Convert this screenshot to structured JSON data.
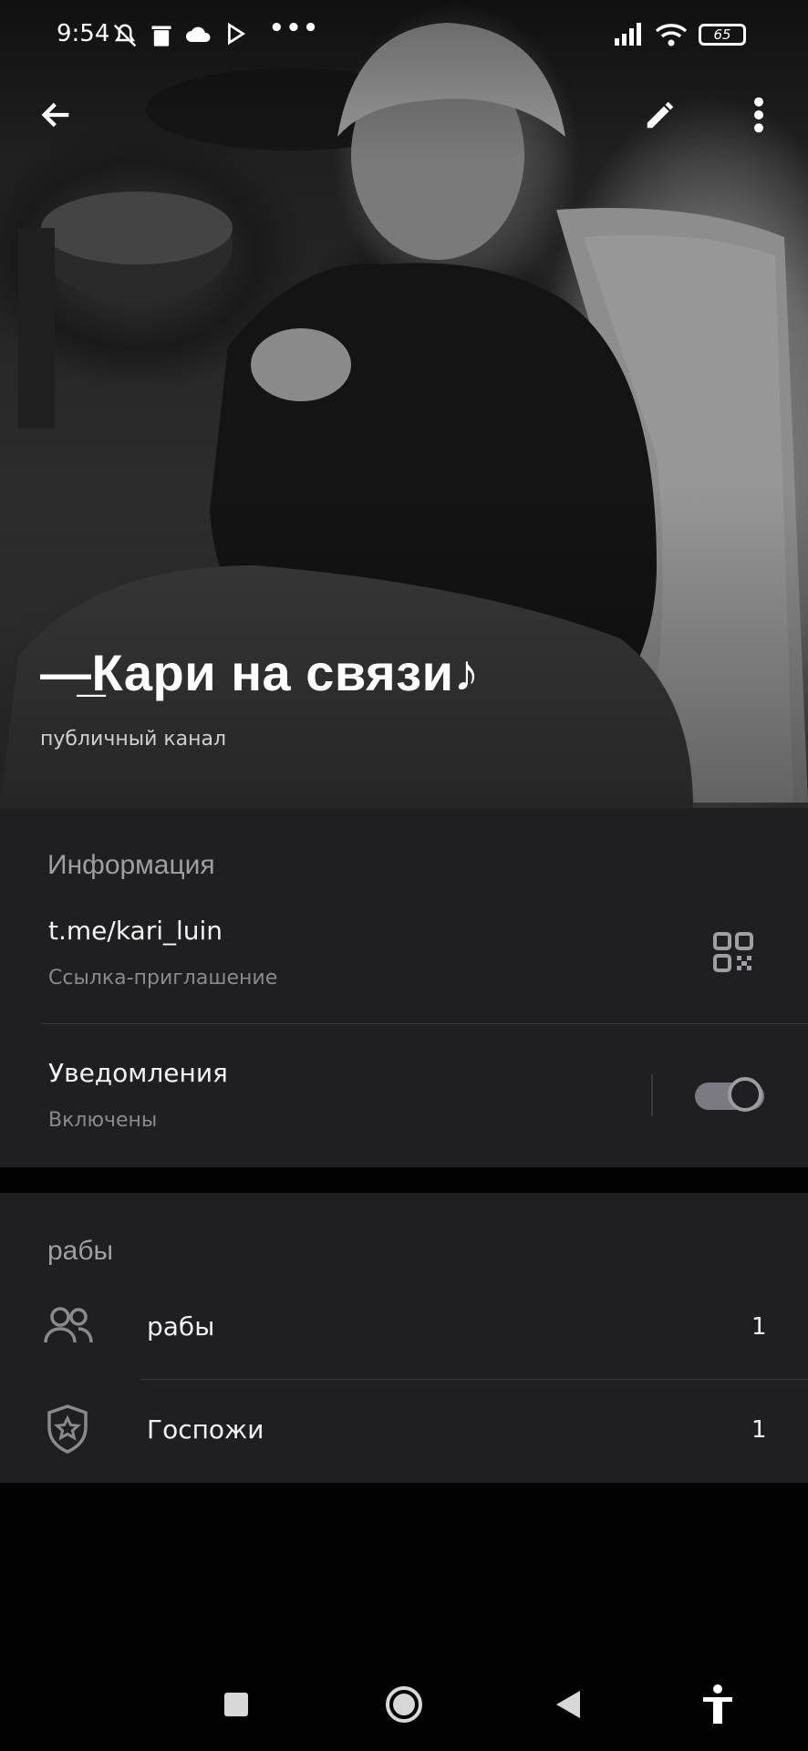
{
  "status_bar": {
    "time": "9:54",
    "battery": "65",
    "more": "•••"
  },
  "toolbar": {
    "back_icon": "arrow-left-icon",
    "edit_icon": "pencil-icon",
    "menu_icon": "more-vertical-icon"
  },
  "channel": {
    "title": "—̲Кари на связи♪",
    "subtitle": "публичный канал"
  },
  "info": {
    "section_title": "Информация",
    "link": "t.me/kari_luin",
    "link_caption": "Ссылка-приглашение",
    "notifications_label": "Уведомления",
    "notifications_status": "Включены",
    "notifications_enabled": true
  },
  "members": {
    "section_title": "рабы",
    "items": [
      {
        "label": "рабы",
        "count": "1",
        "icon": "users-icon"
      },
      {
        "label": "Госпожи",
        "count": "1",
        "icon": "shield-star-icon"
      }
    ]
  },
  "colors": {
    "card_bg": "#1f1e21",
    "page_bg": "#020202",
    "section_title": "#9e9ea4",
    "secondary_text": "#8a8a8e"
  }
}
